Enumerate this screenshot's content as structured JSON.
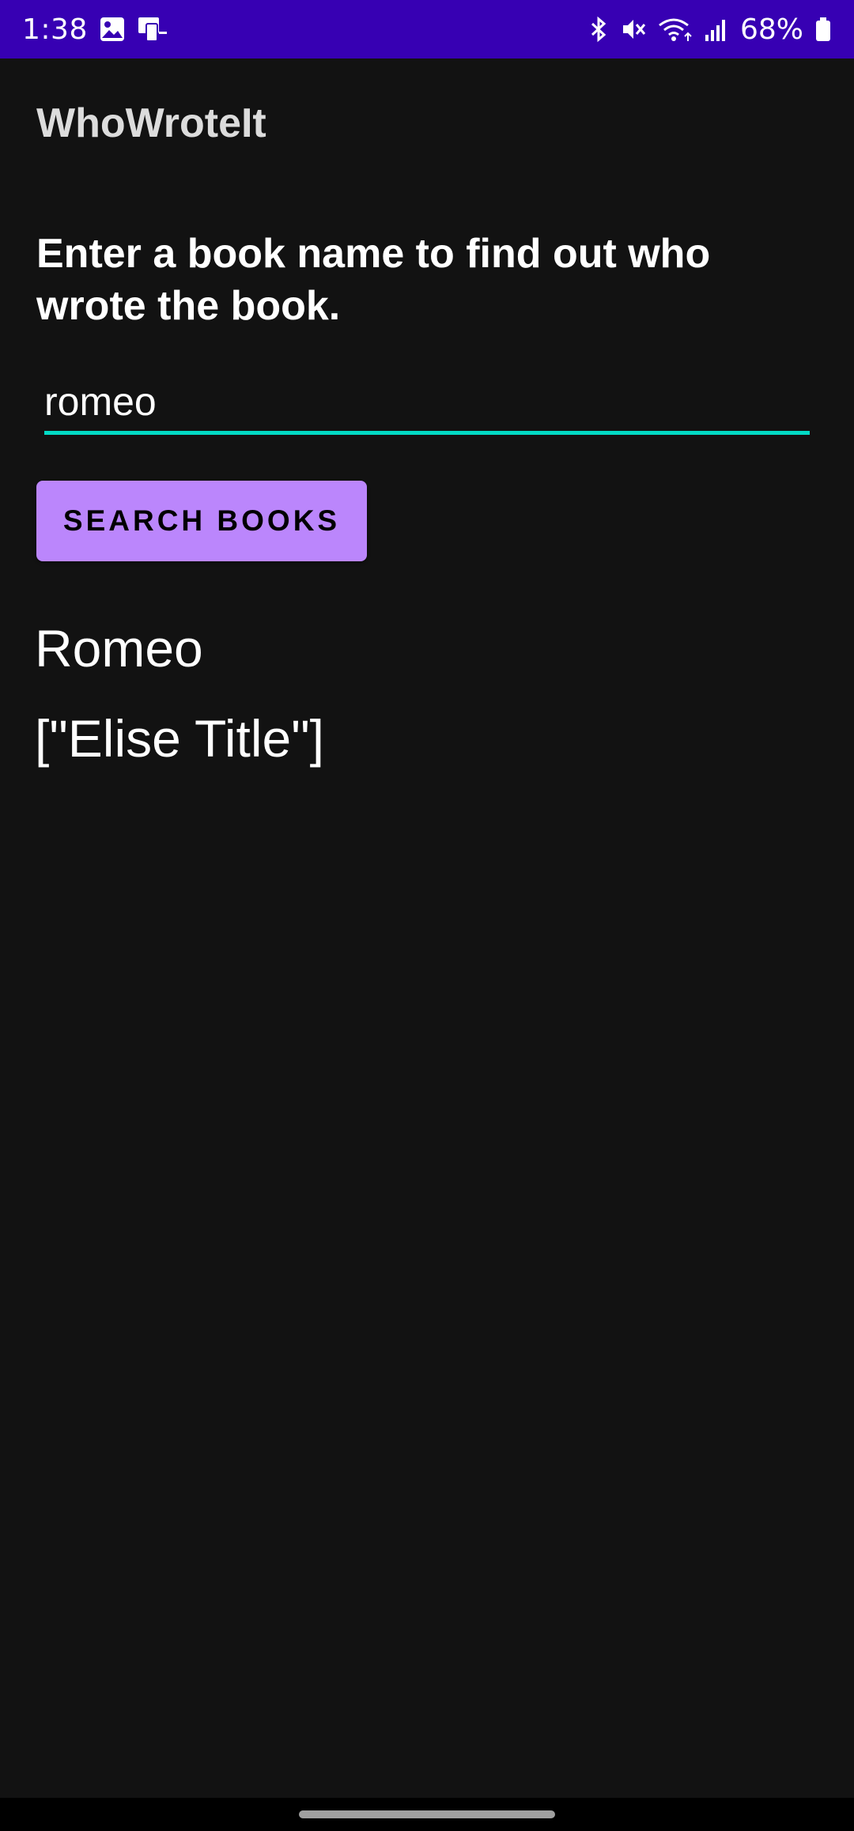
{
  "status_bar": {
    "time": "1:38",
    "battery_percent": "68%",
    "left_icons": [
      "gallery-icon",
      "screen-mirror-icon"
    ],
    "right_icons": [
      "bluetooth-icon",
      "mute-icon",
      "wifi-icon",
      "signal-icon",
      "battery-icon"
    ],
    "background_color": "#3700b3"
  },
  "app_bar": {
    "title": "WhoWroteIt"
  },
  "main": {
    "instructions": "Enter a book name to find out who wrote the book.",
    "search_input_value": "romeo",
    "search_button_label": "Search Books",
    "result_title": "Romeo",
    "result_authors": "[\"Elise Title\"]"
  },
  "colors": {
    "background": "#121212",
    "accent_underline": "#03dac5",
    "button": "#bb86fc"
  }
}
